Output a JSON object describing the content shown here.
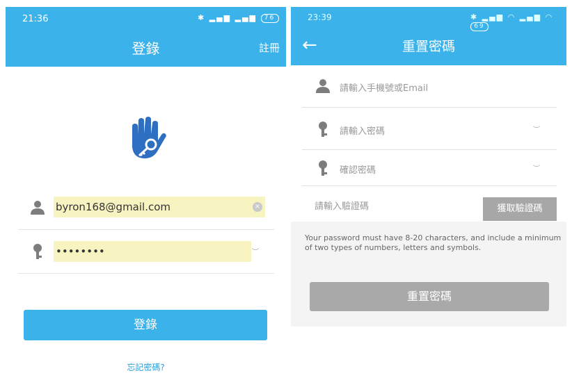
{
  "login_screen": {
    "status": {
      "time": "21:36",
      "battery": "76"
    },
    "title": "登錄",
    "register_link": "註冊",
    "email_value": "byron168@gmail.com",
    "password_value": "••••••••",
    "login_button": "登錄",
    "forgot_link": "忘記密碼?"
  },
  "reset_screen": {
    "status": {
      "time": "23:39",
      "battery": "69"
    },
    "title": "重置密碼",
    "phone_email_placeholder": "請輸入手機號或Email",
    "password_placeholder": "請輸入密碼",
    "confirm_placeholder": "確認密碼",
    "code_placeholder": "請輸入驗證碼",
    "get_code_button": "獲取驗證碼",
    "hint": "Your password must have 8-20 characters, and include a minimum of two types of numbers, letters and symbols.",
    "reset_button": "重置密碼"
  },
  "colors": {
    "accent": "#3cb2ea",
    "disabled": "#a9a9a9",
    "autofill": "#f8f4c2"
  }
}
